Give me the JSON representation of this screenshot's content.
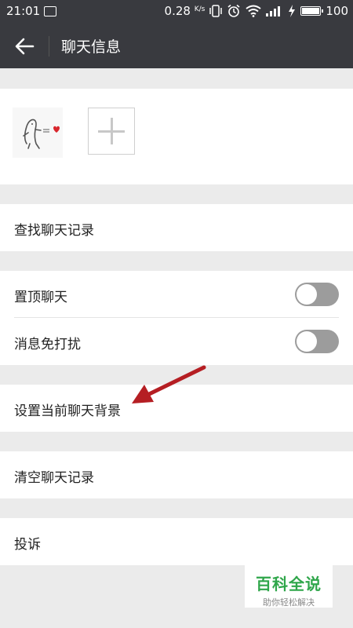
{
  "status_bar": {
    "time": "21:01",
    "speed": "0.28",
    "speed_unit": "K/s",
    "battery": "100"
  },
  "header": {
    "title": "聊天信息"
  },
  "items": {
    "search_history": "查找聊天记录",
    "pin_chat": "置顶聊天",
    "mute_notifications": "消息免打扰",
    "set_background": "设置当前聊天背景",
    "clear_history": "清空聊天记录",
    "report": "投诉"
  },
  "toggles": {
    "pin_chat_on": false,
    "mute_on": false
  },
  "watermark": {
    "main": "百科全说",
    "sub": "助你轻松解决"
  },
  "colors": {
    "header_bg": "#393a3f",
    "background": "#ebebeb",
    "toggle_off": "#9c9c9c",
    "arrow": "#b51e23",
    "watermark_green": "#2fa64a"
  },
  "icons": [
    "back-arrow-icon",
    "image-icon",
    "vibrate-icon",
    "alarm-icon",
    "wifi-icon",
    "signal-icon",
    "charging-icon",
    "battery-icon",
    "add-member-icon"
  ]
}
